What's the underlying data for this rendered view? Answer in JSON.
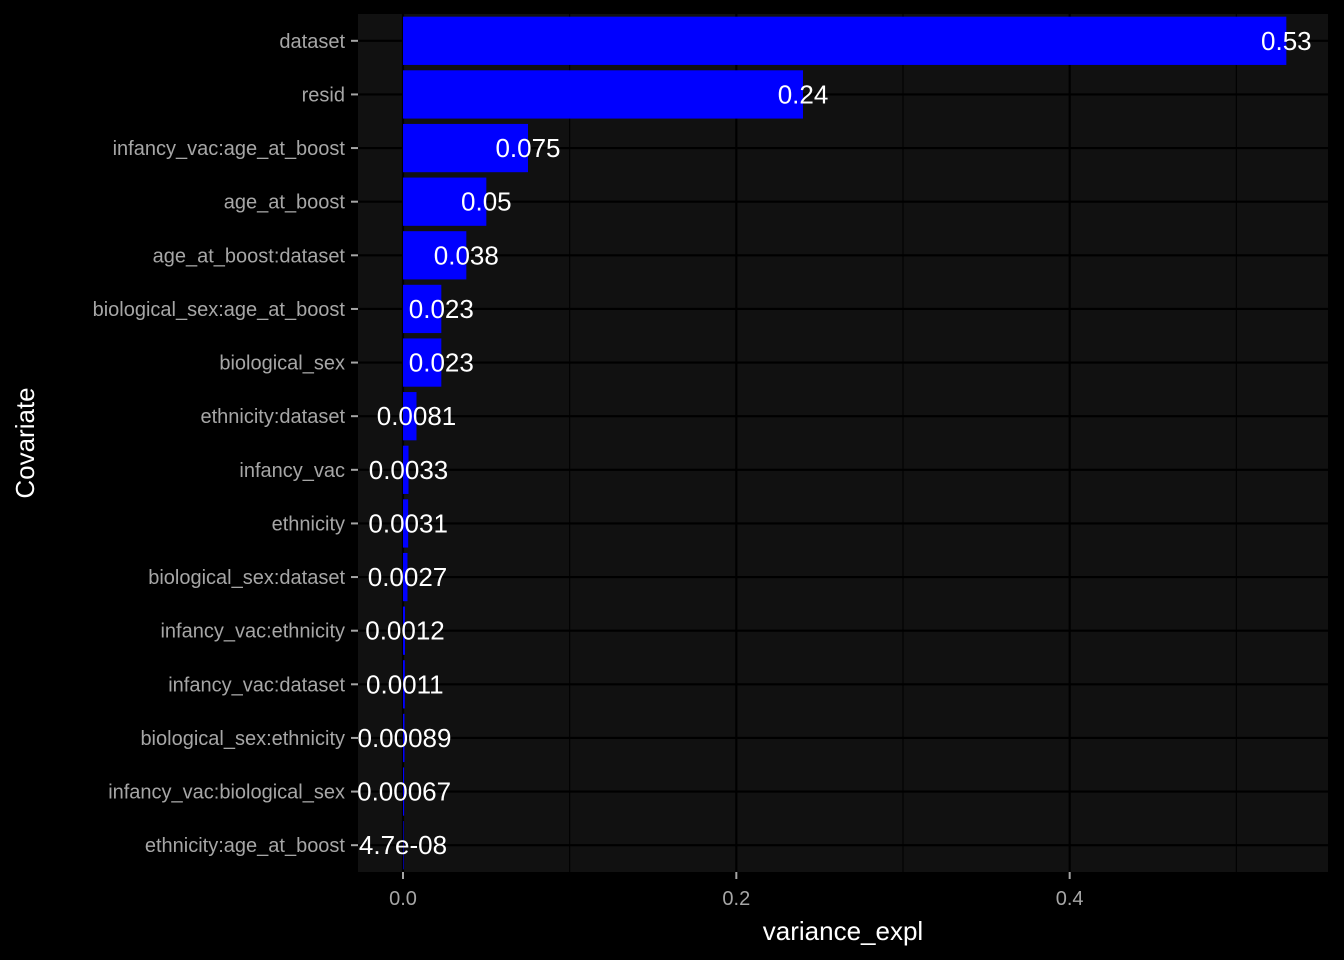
{
  "chart_data": {
    "type": "bar",
    "orientation": "horizontal",
    "xlabel": "variance_expl",
    "ylabel": "Covariate",
    "xlim": [
      -0.027,
      0.555
    ],
    "xticks": [
      0.0,
      0.2,
      0.4
    ],
    "xtick_labels": [
      "0.0",
      "0.2",
      "0.4"
    ],
    "grid": true,
    "colors": {
      "background": "#000000",
      "panel": "#111111",
      "bar": "#0000ff",
      "grid": "#000000",
      "text": "#ffffff",
      "tick_text": "#a6a6a6"
    },
    "categories": [
      "dataset",
      "resid",
      "infancy_vac:age_at_boost",
      "age_at_boost",
      "age_at_boost:dataset",
      "biological_sex:age_at_boost",
      "biological_sex",
      "ethnicity:dataset",
      "infancy_vac",
      "ethnicity",
      "biological_sex:dataset",
      "infancy_vac:ethnicity",
      "infancy_vac:dataset",
      "biological_sex:ethnicity",
      "infancy_vac:biological_sex",
      "ethnicity:age_at_boost"
    ],
    "values": [
      0.53,
      0.24,
      0.075,
      0.05,
      0.038,
      0.023,
      0.023,
      0.0081,
      0.0033,
      0.0031,
      0.0027,
      0.0012,
      0.0011,
      0.00089,
      0.00067,
      4.7e-08
    ],
    "value_labels": [
      "0.53",
      "0.24",
      "0.075",
      "0.05",
      "0.038",
      "0.023",
      "0.023",
      "0.0081",
      "0.0033",
      "0.0031",
      "0.0027",
      "0.0012",
      "0.0011",
      "0.00089",
      "0.00067",
      "4.7e-08"
    ]
  }
}
